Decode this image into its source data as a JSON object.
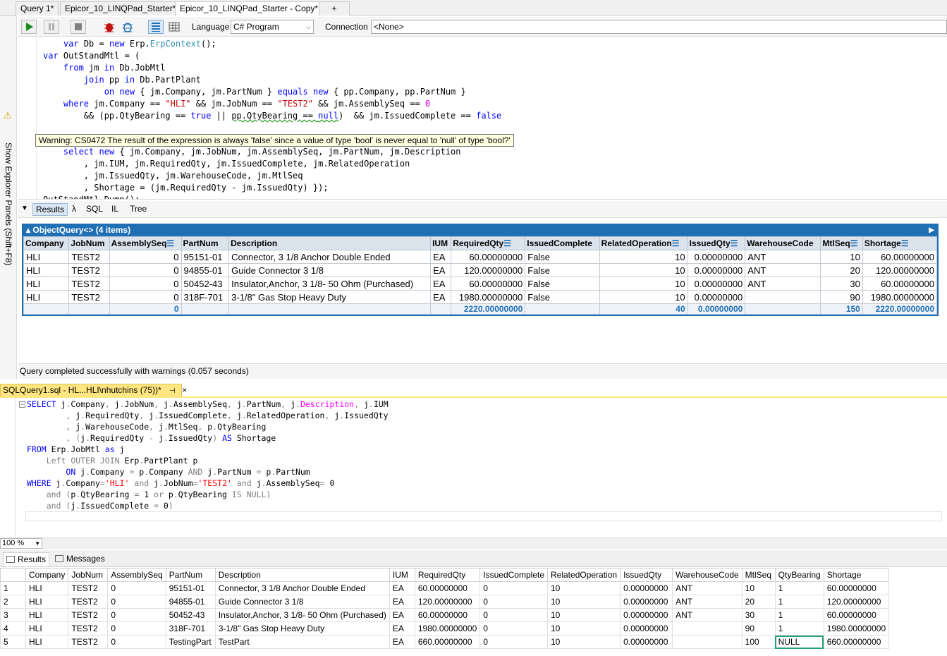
{
  "tabs": [
    {
      "label": "Query 1*"
    },
    {
      "label": "Epicor_10_LINQPad_Starter*"
    },
    {
      "label": "Epicor_10_LINQPad_Starter - Copy*"
    },
    {
      "label": "+"
    }
  ],
  "toolbar": {
    "language_label": "Language",
    "language_value": "C# Program",
    "connection_label": "Connection",
    "connection_value": "<None>"
  },
  "sidebar": {
    "explorer_label": "Show Explorer Panels (Shift+F8)"
  },
  "editor": {
    "warning_tooltip": "Warning: CS0472 The result of the expression is always 'false' since a value of type 'bool' is never equal to 'null' of type 'bool?'"
  },
  "results_tabs": [
    "Results",
    "λ",
    "SQL",
    "IL",
    "Tree"
  ],
  "object_query": {
    "title": "ObjectQuery<> (4 items)",
    "columns": [
      "Company",
      "JobNum",
      "AssemblySeq",
      "PartNum",
      "Description",
      "IUM",
      "RequiredQty",
      "IssuedComplete",
      "RelatedOperation",
      "IssuedQty",
      "WarehouseCode",
      "MtlSeq",
      "Shortage"
    ],
    "summable": [
      false,
      false,
      true,
      false,
      false,
      false,
      true,
      false,
      true,
      true,
      false,
      true,
      true
    ],
    "rows": [
      [
        "HLI",
        "TEST2",
        "0",
        "95151-01",
        "Connector, 3 1/8 Anchor Double Ended",
        "EA",
        "60.00000000",
        "False",
        "10",
        "0.00000000",
        "ANT",
        "10",
        "60.00000000"
      ],
      [
        "HLI",
        "TEST2",
        "0",
        "94855-01",
        "Guide Connector 3 1/8",
        "EA",
        "120.00000000",
        "False",
        "10",
        "0.00000000",
        "ANT",
        "20",
        "120.00000000"
      ],
      [
        "HLI",
        "TEST2",
        "0",
        "50452-43",
        "Insulator,Anchor, 3 1/8- 50 Ohm  (Purchased)",
        "EA",
        "60.00000000",
        "False",
        "10",
        "0.00000000",
        "ANT",
        "30",
        "60.00000000"
      ],
      [
        "HLI",
        "TEST2",
        "0",
        "318F-701",
        "3-1/8\" Gas Stop Heavy Duty",
        "EA",
        "1980.00000000",
        "False",
        "10",
        "0.00000000",
        "",
        "90",
        "1980.00000000"
      ]
    ],
    "totals": [
      "",
      "",
      "0",
      "",
      "",
      "",
      "2220.00000000",
      "",
      "40",
      "0.00000000",
      "",
      "150",
      "2220.00000000"
    ]
  },
  "status1": "Query completed successfully with warnings  (0.057 seconds)",
  "ssms": {
    "tab_title": "SQLQuery1.sql - HL...HLI\\nhutchins (75))*",
    "zoom": "100 %",
    "grid_tabs": [
      "Results",
      "Messages"
    ],
    "columns": [
      "Company",
      "JobNum",
      "AssemblySeq",
      "PartNum",
      "Description",
      "IUM",
      "RequiredQty",
      "IssuedComplete",
      "RelatedOperation",
      "IssuedQty",
      "WarehouseCode",
      "MtlSeq",
      "QtyBearing",
      "Shortage"
    ],
    "rows": [
      [
        "1",
        "HLI",
        "TEST2",
        "0",
        "95151-01",
        "Connector, 3 1/8 Anchor Double Ended",
        "EA",
        "60.00000000",
        "0",
        "10",
        "0.00000000",
        "ANT",
        "10",
        "1",
        "60.00000000"
      ],
      [
        "2",
        "HLI",
        "TEST2",
        "0",
        "94855-01",
        "Guide Connector 3 1/8",
        "EA",
        "120.00000000",
        "0",
        "10",
        "0.00000000",
        "ANT",
        "20",
        "1",
        "120.00000000"
      ],
      [
        "3",
        "HLI",
        "TEST2",
        "0",
        "50452-43",
        "Insulator,Anchor, 3 1/8- 50 Ohm  (Purchased)",
        "EA",
        "60.00000000",
        "0",
        "10",
        "0.00000000",
        "ANT",
        "30",
        "1",
        "60.00000000"
      ],
      [
        "4",
        "HLI",
        "TEST2",
        "0",
        "318F-701",
        "3-1/8\" Gas Stop Heavy Duty",
        "EA",
        "1980.00000000",
        "0",
        "10",
        "0.00000000",
        "",
        "90",
        "1",
        "1980.00000000"
      ],
      [
        "5",
        "HLI",
        "TEST2",
        "0",
        "TestingPart",
        "TestPart",
        "EA",
        "660.00000000",
        "0",
        "10",
        "0.00000000",
        "",
        "100",
        "NULL",
        "660.00000000"
      ]
    ]
  },
  "colors": {
    "accent": "#1f6fb5",
    "highlight": "#26a07a",
    "ssms_tab": "#ffe680"
  }
}
